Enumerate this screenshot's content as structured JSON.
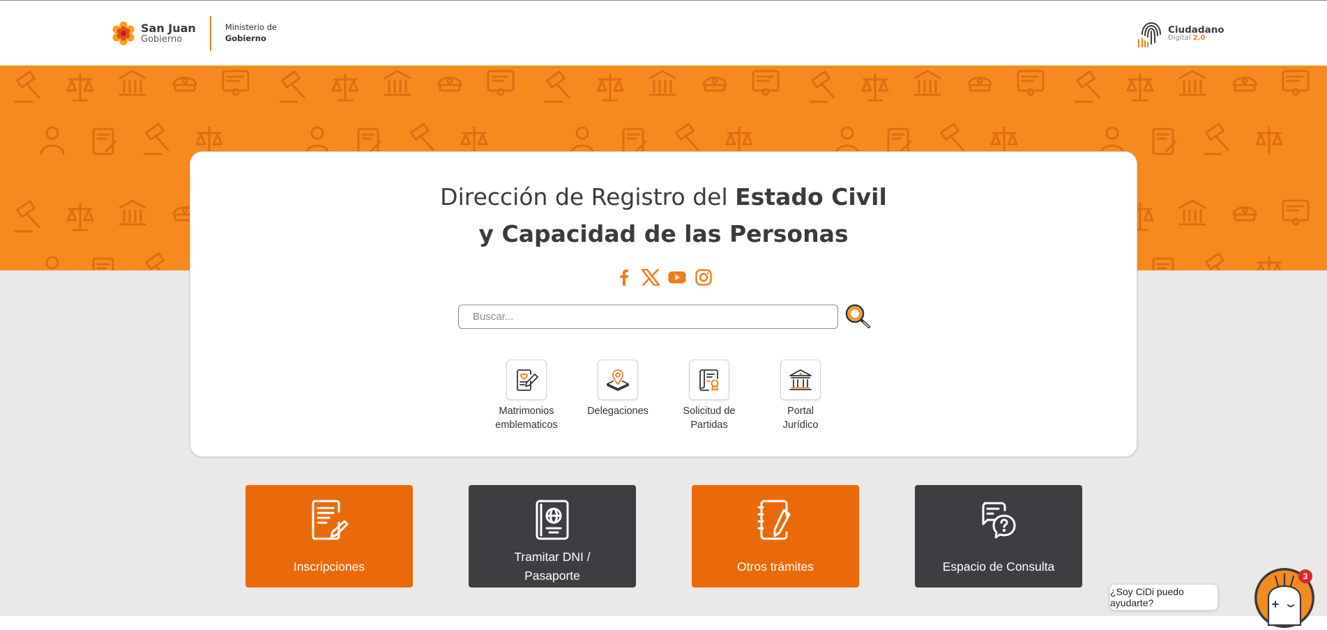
{
  "header": {
    "brand_name": "San Juan",
    "brand_sub": "Gobierno",
    "ministry_line1": "Ministerio de",
    "ministry_line2": "Gobierno",
    "cidi_name": "Ciudadano",
    "cidi_sub": "Digital",
    "cidi_version": "2.0"
  },
  "hero": {
    "title_light_1": "Dirección de Registro del ",
    "title_bold_1": "Estado Civil",
    "title_bold_2": "y Capacidad de las Personas",
    "social": [
      "facebook-icon",
      "x-twitter-icon",
      "youtube-icon",
      "instagram-icon"
    ]
  },
  "search": {
    "placeholder": "Buscar..."
  },
  "quick_links": [
    {
      "label": "Matrimonios\nemblematicos",
      "icon": "marriage-certificate-icon"
    },
    {
      "label": "Delegaciones",
      "icon": "map-location-icon"
    },
    {
      "label": "Solicitud de\nPartidas",
      "icon": "document-seal-icon"
    },
    {
      "label": "Portal\nJurídico",
      "icon": "courthouse-icon"
    }
  ],
  "tiles": [
    {
      "label": "Inscripciones",
      "icon": "form-pen-icon",
      "color": "#ea6a0b"
    },
    {
      "label": "Tramitar DNI /\nPasaporte",
      "icon": "passport-icon",
      "color": "#3f3d41"
    },
    {
      "label": "Otros trámites",
      "icon": "notebook-pen-icon",
      "color": "#ea6a0b"
    },
    {
      "label": "Espacio de Consulta",
      "icon": "chat-question-icon",
      "color": "#3f3d41"
    }
  ],
  "chat": {
    "bubble_text": "¿Soy CiDi puedo ayudarte?",
    "badge_count": "3"
  },
  "colors": {
    "accent": "#ef7d1a",
    "tile_orange": "#ea6a0b",
    "tile_dark": "#3f3d41",
    "hero_bg": "#f78a1e",
    "page_bg": "#ebe9e8"
  }
}
